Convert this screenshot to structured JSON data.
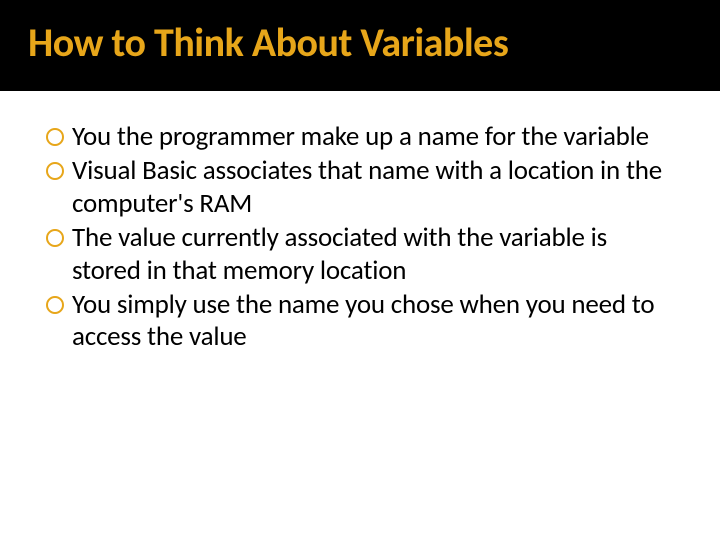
{
  "slide": {
    "title": "How to Think About Variables",
    "bullets": [
      "You the programmer make up a name for the variable",
      "Visual Basic associates that name with a location in the computer's RAM",
      "The value currently associated with the variable is stored in that memory location",
      "You simply use the name you chose when you need to access the value"
    ]
  },
  "colors": {
    "accent": "#e7a61a",
    "title_bg": "#000000",
    "body_text": "#000000"
  }
}
